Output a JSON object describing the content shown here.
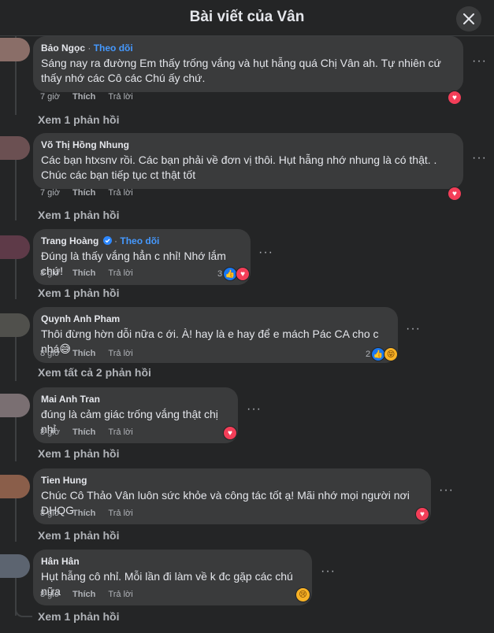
{
  "header": {
    "title": "Bài viết của Vân"
  },
  "comments": [
    {
      "author": "Bảo Ngọc",
      "follow": "Theo dõi",
      "verified": false,
      "text": "Sáng nay ra đường Em thấy trống vắng và hụt hẫng quá Chị Vân ah. Tự nhiên cứ thấy nhớ các Cô các Chú ấy chứ.",
      "time": "7 giờ",
      "like": "Thích",
      "reply": "Trả lời",
      "react_count": "",
      "replies": "Xem 1 phản hồi"
    },
    {
      "author": "Võ Thị Hồng Nhung",
      "follow": "",
      "verified": false,
      "text": "Các bạn htxsnv rồi. Các bạn phải về đơn vị thôi. Hụt hẫng nhớ nhung là có thật. . Chúc các bạn tiếp tục ct thật tốt",
      "time": "7 giờ",
      "like": "Thích",
      "reply": "Trả lời",
      "react_count": "",
      "replies": "Xem 1 phản hồi"
    },
    {
      "author": "Trang Hoàng",
      "follow": "Theo dõi",
      "verified": true,
      "text": "Đúng là thấy vắng hẳn c nhỉ! Nhớ lắm chứ!",
      "time": "8 giờ",
      "like": "Thích",
      "reply": "Trả lời",
      "react_count": "3",
      "replies": "Xem 1 phản hồi"
    },
    {
      "author": "Quynh Anh Pham",
      "follow": "",
      "verified": false,
      "text": "Thôi đừng hờn dỗi nữa c ới. À! hay là e hay để e mách Pác CA cho c nhá😅",
      "time": "8 giờ",
      "like": "Thích",
      "reply": "Trả lời",
      "react_count": "2",
      "replies": "Xem tất cả 2 phản hồi"
    },
    {
      "author": "Mai Anh Tran",
      "follow": "",
      "verified": false,
      "text": "đúng là cảm giác trống vắng thật chị nhỉ",
      "time": "8 giờ",
      "like": "Thích",
      "reply": "Trả lời",
      "react_count": "",
      "replies": "Xem 1 phản hồi"
    },
    {
      "author": "Tien Hung",
      "follow": "",
      "verified": false,
      "text": "Chúc Cô Thảo Vân luôn sức khỏe và công tác tốt ạ! Mãi nhớ mọi người nơi ĐHQG",
      "time": "8 giờ",
      "like": "Thích",
      "reply": "Trả lời",
      "react_count": "",
      "replies": "Xem 1 phản hồi"
    },
    {
      "author": "Hân Hân",
      "follow": "",
      "verified": false,
      "text": "Hụt hẫng cô nhỉ. Mỗi lần đi làm về k đc gặp các chú nữa",
      "time": "8 giờ",
      "like": "Thích",
      "reply": "Trả lời",
      "react_count": "",
      "replies": "Xem 1 phản hồi"
    }
  ],
  "colors": {
    "background": "#242526",
    "bubble": "#3a3b3c",
    "link": "#4599ff",
    "love": "#f33e58",
    "like": "#1877f2"
  }
}
